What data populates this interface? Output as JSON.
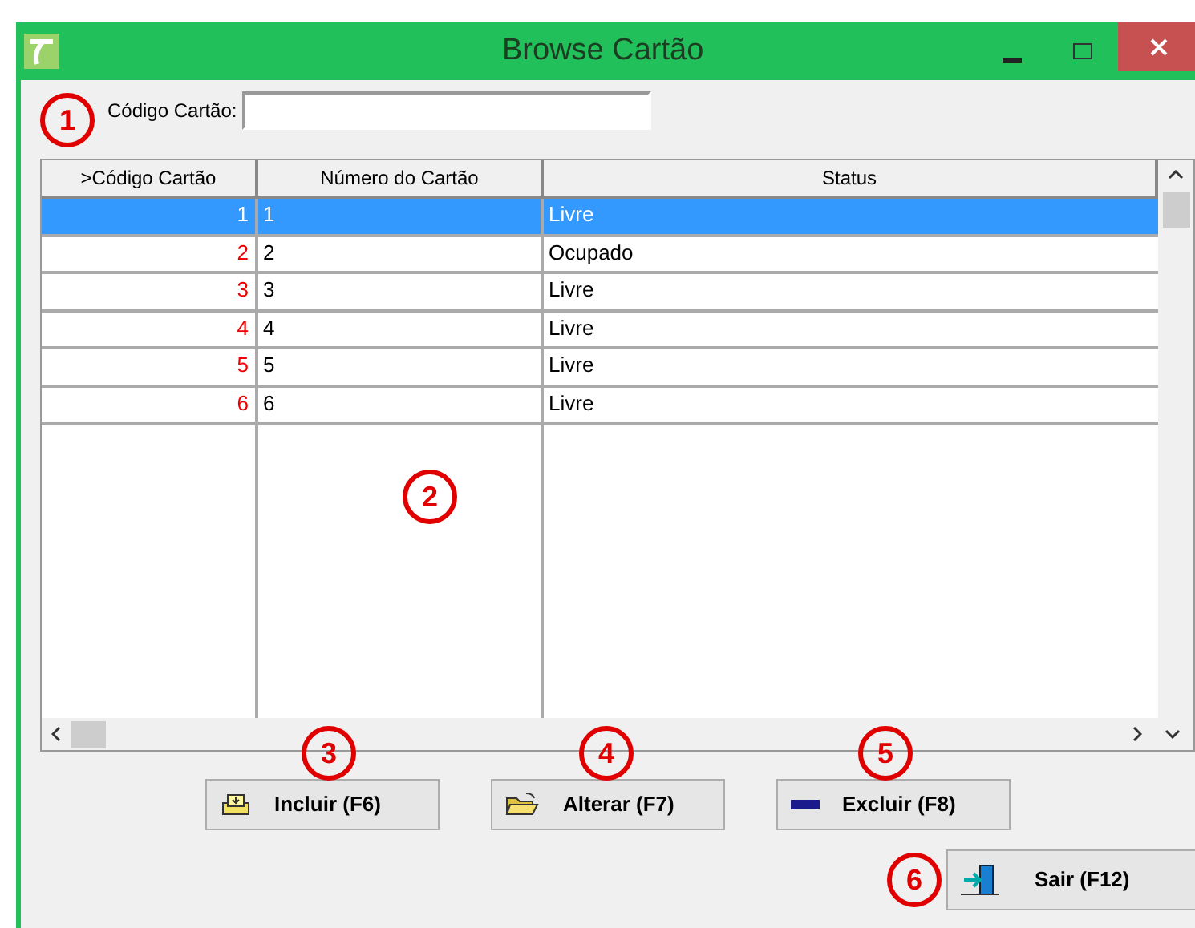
{
  "window": {
    "title": "Browse Cartão"
  },
  "search": {
    "label": "Código Cartão:"
  },
  "table": {
    "columns": [
      ">Código Cartão",
      "Número do Cartão",
      "Status"
    ],
    "rows": [
      {
        "code": "1",
        "number": "1",
        "status": "Livre",
        "selected": true
      },
      {
        "code": "2",
        "number": "2",
        "status": "Ocupado",
        "selected": false
      },
      {
        "code": "3",
        "number": "3",
        "status": "Livre",
        "selected": false
      },
      {
        "code": "4",
        "number": "4",
        "status": "Livre",
        "selected": false
      },
      {
        "code": "5",
        "number": "5",
        "status": "Livre",
        "selected": false
      },
      {
        "code": "6",
        "number": "6",
        "status": "Livre",
        "selected": false
      }
    ]
  },
  "buttons": [
    {
      "kind": "add",
      "label": "Incluir (F6)"
    },
    {
      "kind": "edit",
      "label": "Alterar (F7)"
    },
    {
      "kind": "delete",
      "label": "Excluir (F8)"
    }
  ],
  "exit_button": {
    "label": "Sair (F12)"
  },
  "callouts": [
    "1",
    "2",
    "3",
    "4",
    "5",
    "6"
  ]
}
